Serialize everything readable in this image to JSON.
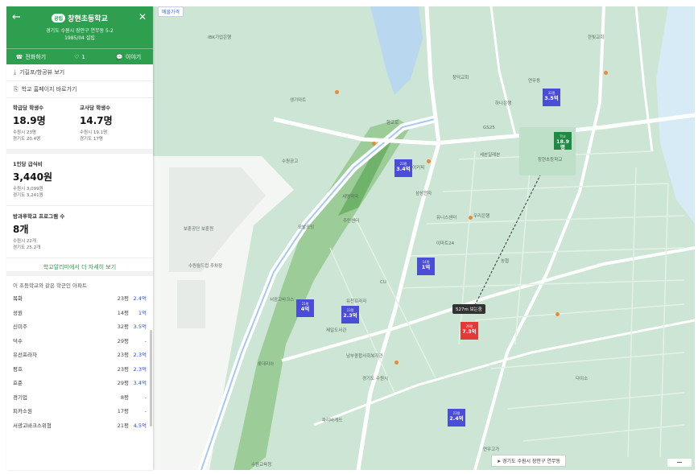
{
  "header": {
    "badge": "공립",
    "title": "창현초등학교",
    "address_line1": "경기도 수원시 장안구 연무동 5-2",
    "address_line2": "1985/04 설립",
    "back_icon": "arrow-left-icon",
    "close_icon": "close-icon",
    "actions": [
      {
        "icon": "phone-icon",
        "label": "전화하기"
      },
      {
        "icon": "heart-icon",
        "label": "1"
      },
      {
        "icon": "chat-icon",
        "label": "이야기"
      }
    ]
  },
  "links": {
    "map_view": "기길포/항공뷰 보기",
    "homepage": "학교 홈페이지 바로가기"
  },
  "stats": {
    "students_per_class": {
      "label": "학급당 학생수",
      "value": "18.9명",
      "sub1": "수원시 23명",
      "sub2": "경기도 20.4명"
    },
    "students_per_teacher": {
      "label": "교사당 학생수",
      "value": "14.7명",
      "sub1": "수원시 19.1명",
      "sub2": "경기도 17명"
    },
    "meal_cost": {
      "label": "1인당 급식비",
      "value": "3,440원",
      "sub1": "수원시 3,099원",
      "sub2": "경기도 3,241원"
    },
    "afterschool": {
      "label": "방과후학교 프로그램 수",
      "value": "8개",
      "sub1": "수원시 22개",
      "sub2": "경기도 25.2개"
    }
  },
  "more_link": "학교알리미에서 더 자세히 보기",
  "apartments": {
    "title": "이 초등학교와 같은 학군인 아파트",
    "items": [
      {
        "name": "목화",
        "count": "23평",
        "price": "2.4억"
      },
      {
        "name": "성원",
        "count": "14평",
        "price": "1억"
      },
      {
        "name": "신미주",
        "count": "32평",
        "price": "3.5억"
      },
      {
        "name": "덕수",
        "count": "29평",
        "price": "-"
      },
      {
        "name": "유선프라자",
        "count": "23평",
        "price": "2.3억"
      },
      {
        "name": "평호",
        "count": "23평",
        "price": "2.3억"
      },
      {
        "name": "효준",
        "count": "29평",
        "price": "3.4억"
      },
      {
        "name": "경기업",
        "count": "8평",
        "price": "-"
      },
      {
        "name": "피카소원",
        "count": "17평",
        "price": "-"
      },
      {
        "name": "서광고바크스위첨",
        "count": "21평",
        "price": "4.5억"
      }
    ]
  },
  "map": {
    "tag": "매물가격",
    "walk_label": "527m 보는중",
    "location": "경기도 수원시 장안구 연무동",
    "markers": [
      {
        "id": "m1",
        "top": "23평",
        "price": "3.4억",
        "color": "blue"
      },
      {
        "id": "m2",
        "top": "32평",
        "price": "3.5억",
        "color": "blue"
      },
      {
        "id": "m3",
        "top": "14평",
        "price": "1억",
        "color": "blue"
      },
      {
        "id": "m4",
        "top": "21평",
        "price": "4억",
        "color": "blue"
      },
      {
        "id": "m5",
        "top": "23평",
        "price": "2.3억",
        "color": "blue"
      },
      {
        "id": "m6",
        "top": "23평",
        "price": "2.4억",
        "color": "blue"
      },
      {
        "id": "m7",
        "top": "29평",
        "price": "7.3억",
        "color": "red"
      },
      {
        "id": "m8",
        "top": "학교",
        "price": "18.9명",
        "color": "green"
      }
    ],
    "pois": [
      "IBK기업은행",
      "향교로",
      "생기마트",
      "수원공고",
      "세명약국",
      "모발포밍",
      "이디야커피",
      "GS25",
      "하나은행",
      "CU",
      "연무동",
      "창덕교회",
      "서광고바크스",
      "유천프라자",
      "삼성전자",
      "제일도서관",
      "남부종합사회복지관",
      "경기도 수원시",
      "파리바게뜨",
      "롯데리아",
      "유니스센터",
      "주민센터",
      "창현초등학교",
      "보훈공단 보훈원",
      "수원월드컵 주차장",
      "이마트24",
      "세븐일레븐",
      "다이소",
      "한빛교회",
      "농협",
      "우리은행",
      "연무고가",
      "수원교육청"
    ]
  }
}
